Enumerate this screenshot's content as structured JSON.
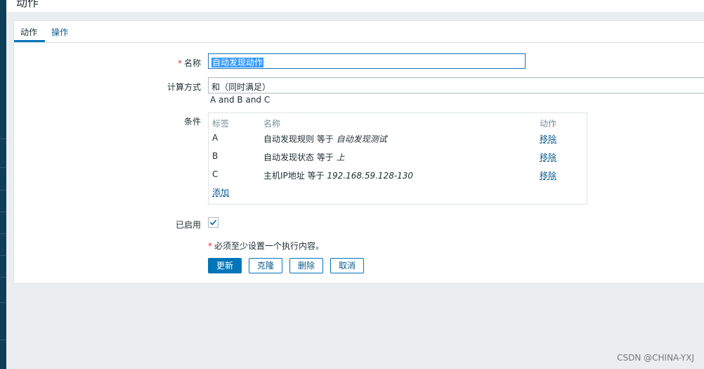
{
  "page": {
    "title_partial": "动作"
  },
  "tabs": [
    {
      "label": "动作"
    },
    {
      "label": "操作"
    }
  ],
  "form": {
    "name_label": "名称",
    "name_value": "自动发现动作",
    "calc_label": "计算方式",
    "calc_value": "和（同时满足）",
    "formula": "A and B and C",
    "conditions_label": "条件",
    "table": {
      "headers": [
        "标签",
        "名称",
        "动作"
      ],
      "rows": [
        {
          "tag": "A",
          "text": "自动发现规则 等于 ",
          "value": "自动发现测试",
          "action": "移除"
        },
        {
          "tag": "B",
          "text": "自动发现状态 等于 ",
          "value": "上",
          "action": "移除"
        },
        {
          "tag": "C",
          "text": "主机IP地址 等于 ",
          "value": "192.168.59.128-130",
          "action": "移除"
        }
      ],
      "add_label": "添加"
    },
    "enabled_label": "已启用",
    "enabled": true,
    "note": "必须至少设置一个执行内容。"
  },
  "buttons": {
    "update": "更新",
    "clone": "克隆",
    "delete": "删除",
    "cancel": "取消"
  },
  "watermark": "CSDN @CHINA-YXJ",
  "colors": {
    "accent": "#0275b8",
    "link": "#0b5b8f",
    "sidebar": "#0e3f58",
    "required": "#e33734"
  }
}
